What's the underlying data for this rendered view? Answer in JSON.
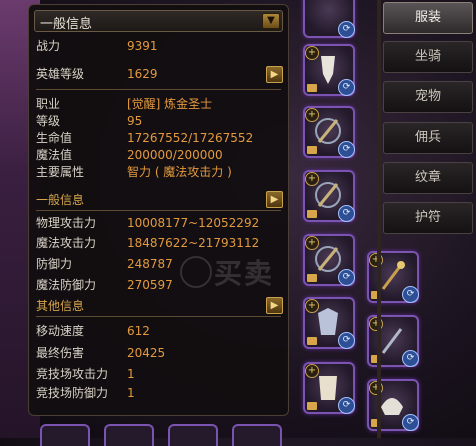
{
  "dropdown": {
    "selected": "一般信息"
  },
  "stats_top": [
    {
      "key": "战力",
      "value": "9391"
    },
    {
      "key": "英雄等级",
      "value": "1629"
    }
  ],
  "profile": [
    {
      "key": "职业",
      "value": "[觉醒] 炼金圣士"
    },
    {
      "key": "等级",
      "value": "95"
    },
    {
      "key": "生命值",
      "value": "17267552/17267552"
    },
    {
      "key": "魔法值",
      "value": "200000/200000"
    },
    {
      "key": "主要属性",
      "value": "智力 ( 魔法攻击力 )"
    }
  ],
  "section_general": {
    "label": "一般信息"
  },
  "attack": [
    {
      "key": "物理攻击力",
      "value": "10008177~12052292"
    },
    {
      "key": "魔法攻击力",
      "value": "18487622~21793112"
    },
    {
      "key": "防御力",
      "value": "248787"
    },
    {
      "key": "魔法防御力",
      "value": "270597"
    }
  ],
  "section_other": {
    "label": "其他信息"
  },
  "other": [
    {
      "key": "移动速度",
      "value": "612"
    },
    {
      "key": "最终伤害",
      "value": "20425"
    },
    {
      "key": "竞技场攻击力",
      "value": "1"
    },
    {
      "key": "竞技场防御力",
      "value": "1"
    }
  ],
  "watermark": "买卖",
  "side_tabs": [
    "服装",
    "坐骑",
    "宠物",
    "佣兵",
    "纹章",
    "护符"
  ],
  "colors": {
    "value": "#e39a3e",
    "label": "#d8d2c6",
    "section": "#d7a64a",
    "slot_border": "#7b53b0"
  }
}
